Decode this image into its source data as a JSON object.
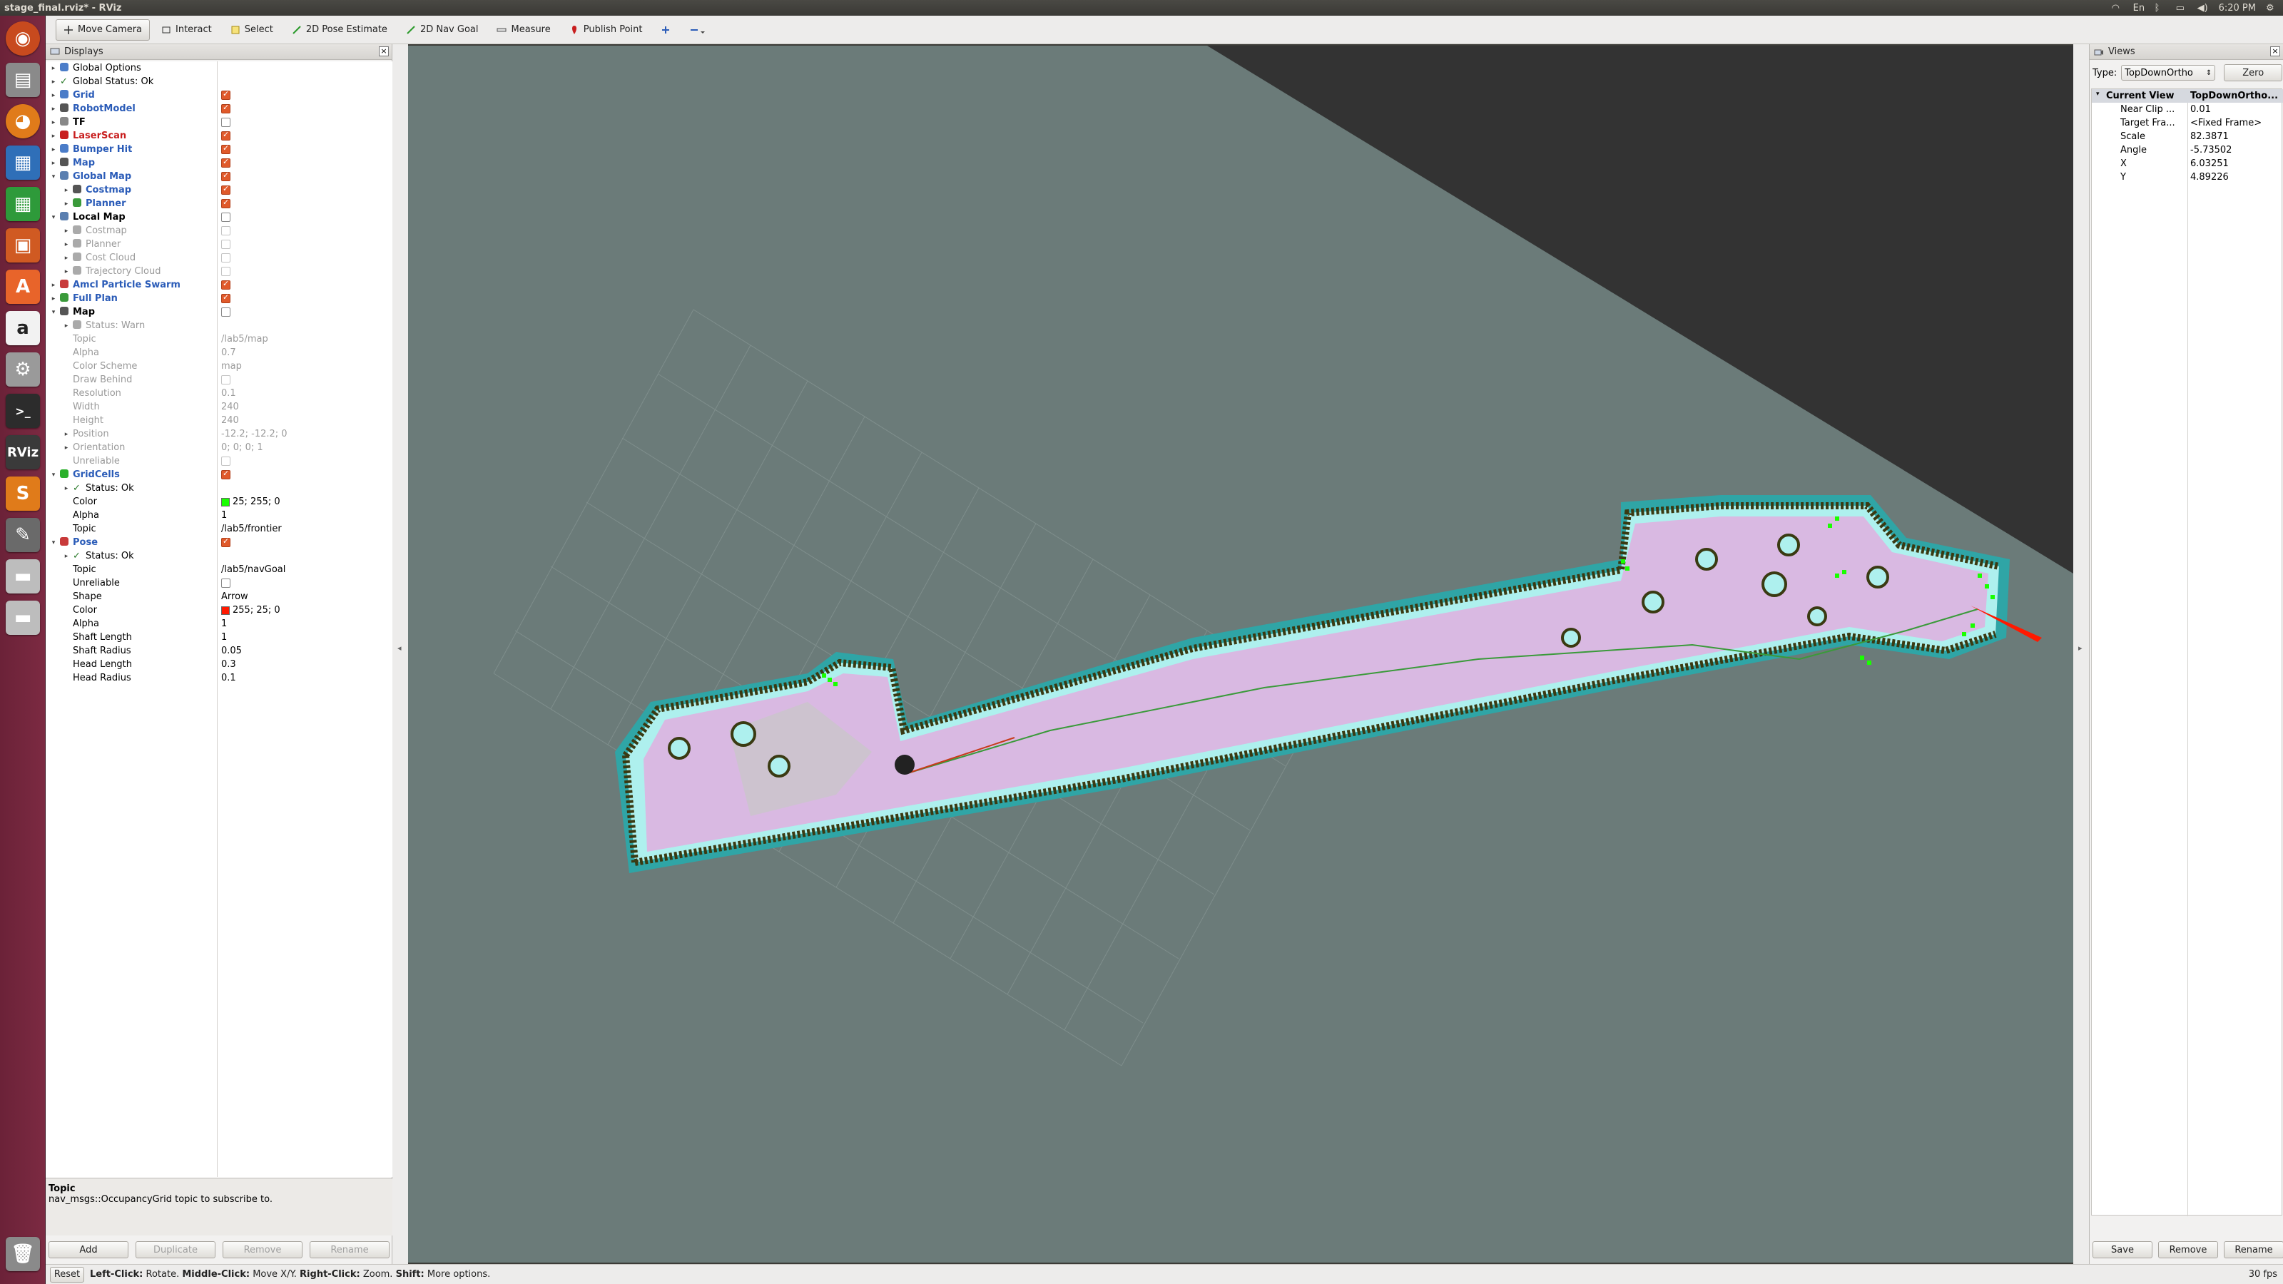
{
  "window": {
    "title": "stage_final.rviz* - RViz",
    "clock": "6:20 PM"
  },
  "toolbar": {
    "tools": [
      {
        "label": "Move Camera",
        "icon": "move-camera-icon",
        "active": true
      },
      {
        "label": "Interact",
        "icon": "interact-icon"
      },
      {
        "label": "Select",
        "icon": "select-icon"
      },
      {
        "label": "2D Pose Estimate",
        "icon": "pose-estimate-icon"
      },
      {
        "label": "2D Nav Goal",
        "icon": "nav-goal-icon"
      },
      {
        "label": "Measure",
        "icon": "measure-icon"
      },
      {
        "label": "Publish Point",
        "icon": "publish-point-icon"
      }
    ]
  },
  "displays": {
    "title": "Displays",
    "rows": [
      {
        "name": "Global Options",
        "indent": 0,
        "arrow": "▸",
        "icon": "#4a7cc8",
        "style": ""
      },
      {
        "name": "Global Status: Ok",
        "indent": 0,
        "arrow": "▸",
        "icon": "check",
        "style": ""
      },
      {
        "name": "Grid",
        "indent": 0,
        "arrow": "▸",
        "icon": "#4a7cc8",
        "style": "enabled",
        "check": "on"
      },
      {
        "name": "RobotModel",
        "indent": 0,
        "arrow": "▸",
        "icon": "#555",
        "style": "enabled",
        "check": "on"
      },
      {
        "name": "TF",
        "indent": 0,
        "arrow": "▸",
        "icon": "#888",
        "style": "bold",
        "check": "off"
      },
      {
        "name": "LaserScan",
        "indent": 0,
        "arrow": "▸",
        "icon": "#c81e1e",
        "style": "err",
        "check": "on"
      },
      {
        "name": "Bumper Hit",
        "indent": 0,
        "arrow": "▸",
        "icon": "#4a7cc8",
        "style": "enabled",
        "check": "on"
      },
      {
        "name": "Map",
        "indent": 0,
        "arrow": "▸",
        "icon": "#555",
        "style": "enabled",
        "check": "on"
      },
      {
        "name": "Global Map",
        "indent": 0,
        "arrow": "▾",
        "icon": "#5a7fb0",
        "style": "enabled",
        "check": "on"
      },
      {
        "name": "Costmap",
        "indent": 1,
        "arrow": "▸",
        "icon": "#555",
        "style": "enabled",
        "check": "on"
      },
      {
        "name": "Planner",
        "indent": 1,
        "arrow": "▸",
        "icon": "#3a9a3a",
        "style": "enabled",
        "check": "on"
      },
      {
        "name": "Local Map",
        "indent": 0,
        "arrow": "▾",
        "icon": "#5a7fb0",
        "style": "bold",
        "check": "off"
      },
      {
        "name": "Costmap",
        "indent": 1,
        "arrow": "▸",
        "icon": "#aaa",
        "style": "dim",
        "check": "dim"
      },
      {
        "name": "Planner",
        "indent": 1,
        "arrow": "▸",
        "icon": "#aaa",
        "style": "dim",
        "check": "dim"
      },
      {
        "name": "Cost Cloud",
        "indent": 1,
        "arrow": "▸",
        "icon": "#aaa",
        "style": "dim",
        "check": "dim"
      },
      {
        "name": "Trajectory Cloud",
        "indent": 1,
        "arrow": "▸",
        "icon": "#aaa",
        "style": "dim",
        "check": "dim"
      },
      {
        "name": "Amcl Particle Swarm",
        "indent": 0,
        "arrow": "▸",
        "icon": "#c83a3a",
        "style": "enabled",
        "check": "on"
      },
      {
        "name": "Full Plan",
        "indent": 0,
        "arrow": "▸",
        "icon": "#3a9a3a",
        "style": "enabled",
        "check": "on"
      },
      {
        "name": "Map",
        "indent": 0,
        "arrow": "▾",
        "icon": "#555",
        "style": "bold",
        "check": "off"
      },
      {
        "name": "Status: Warn",
        "indent": 1,
        "arrow": "▸",
        "icon": "#aaa",
        "style": "dim"
      },
      {
        "name": "Topic",
        "indent": 1,
        "arrow": "",
        "style": "dim",
        "value": "/lab5/map"
      },
      {
        "name": "Alpha",
        "indent": 1,
        "arrow": "",
        "style": "dim",
        "value": "0.7"
      },
      {
        "name": "Color Scheme",
        "indent": 1,
        "arrow": "",
        "style": "dim",
        "value": "map"
      },
      {
        "name": "Draw Behind",
        "indent": 1,
        "arrow": "",
        "style": "dim",
        "check": "dim"
      },
      {
        "name": "Resolution",
        "indent": 1,
        "arrow": "",
        "style": "dim",
        "value": "0.1"
      },
      {
        "name": "Width",
        "indent": 1,
        "arrow": "",
        "style": "dim",
        "value": "240"
      },
      {
        "name": "Height",
        "indent": 1,
        "arrow": "",
        "style": "dim",
        "value": "240"
      },
      {
        "name": "Position",
        "indent": 1,
        "arrow": "▸",
        "style": "dim",
        "value": "-12.2; -12.2; 0"
      },
      {
        "name": "Orientation",
        "indent": 1,
        "arrow": "▸",
        "style": "dim",
        "value": "0; 0; 0; 1"
      },
      {
        "name": "Unreliable",
        "indent": 1,
        "arrow": "",
        "style": "dim",
        "check": "dim"
      },
      {
        "name": "GridCells",
        "indent": 0,
        "arrow": "▾",
        "icon": "#2ab02a",
        "style": "enabled",
        "check": "on"
      },
      {
        "name": "Status: Ok",
        "indent": 1,
        "arrow": "▸",
        "icon": "check",
        "style": ""
      },
      {
        "name": "Color",
        "indent": 1,
        "arrow": "",
        "style": "",
        "value": "25; 255; 0",
        "swatch": "#19ff00"
      },
      {
        "name": "Alpha",
        "indent": 1,
        "arrow": "",
        "style": "",
        "value": "1"
      },
      {
        "name": "Topic",
        "indent": 1,
        "arrow": "",
        "style": "",
        "value": "/lab5/frontier"
      },
      {
        "name": "Pose",
        "indent": 0,
        "arrow": "▾",
        "icon": "#c83a3a",
        "style": "enabled",
        "check": "on"
      },
      {
        "name": "Status: Ok",
        "indent": 1,
        "arrow": "▸",
        "icon": "check",
        "style": ""
      },
      {
        "name": "Topic",
        "indent": 1,
        "arrow": "",
        "style": "",
        "value": "/lab5/navGoal"
      },
      {
        "name": "Unreliable",
        "indent": 1,
        "arrow": "",
        "style": "",
        "check": "off"
      },
      {
        "name": "Shape",
        "indent": 1,
        "arrow": "",
        "style": "",
        "value": "Arrow"
      },
      {
        "name": "Color",
        "indent": 1,
        "arrow": "",
        "style": "",
        "value": "255; 25; 0",
        "swatch": "#ff1900"
      },
      {
        "name": "Alpha",
        "indent": 1,
        "arrow": "",
        "style": "",
        "value": "1"
      },
      {
        "name": "Shaft Length",
        "indent": 1,
        "arrow": "",
        "style": "",
        "value": "1"
      },
      {
        "name": "Shaft Radius",
        "indent": 1,
        "arrow": "",
        "style": "",
        "value": "0.05"
      },
      {
        "name": "Head Length",
        "indent": 1,
        "arrow": "",
        "style": "",
        "value": "0.3"
      },
      {
        "name": "Head Radius",
        "indent": 1,
        "arrow": "",
        "style": "",
        "value": "0.1"
      }
    ],
    "desc_title": "Topic",
    "desc_text": "nav_msgs::OccupancyGrid topic to subscribe to.",
    "buttons": [
      "Add",
      "Duplicate",
      "Remove",
      "Rename"
    ]
  },
  "views": {
    "title": "Views",
    "type_label": "Type:",
    "type_value": "TopDownOrtho",
    "zero_label": "Zero",
    "current_view": {
      "name": "Current View",
      "type": "TopDownOrtho..."
    },
    "props": [
      {
        "k": "Near Clip ...",
        "v": "0.01"
      },
      {
        "k": "Target Fra...",
        "v": "<Fixed Frame>"
      },
      {
        "k": "Scale",
        "v": "82.3871"
      },
      {
        "k": "Angle",
        "v": "-5.73502"
      },
      {
        "k": "X",
        "v": "6.03251"
      },
      {
        "k": "Y",
        "v": "4.89226"
      }
    ],
    "buttons": [
      "Save",
      "Remove",
      "Rename"
    ]
  },
  "status": {
    "reset": "Reset",
    "hint_1": "Left-Click:",
    "hint_1b": "Rotate.",
    "hint_2": "Middle-Click:",
    "hint_2b": "Move X/Y.",
    "hint_3": "Right-Click:",
    "hint_3b": "Zoom.",
    "hint_4": "Shift:",
    "hint_4b": "More options.",
    "fps": "30 fps"
  },
  "colors": {
    "viewport_bg": "#6b7b79",
    "costmap_outer": "#3fa9aa",
    "costmap_inner": "#aef0ee",
    "free_space": "#d9b9e2",
    "frontier": "#19ff00",
    "goal_arrow": "#ff1900",
    "path": "#3a9a3a"
  }
}
